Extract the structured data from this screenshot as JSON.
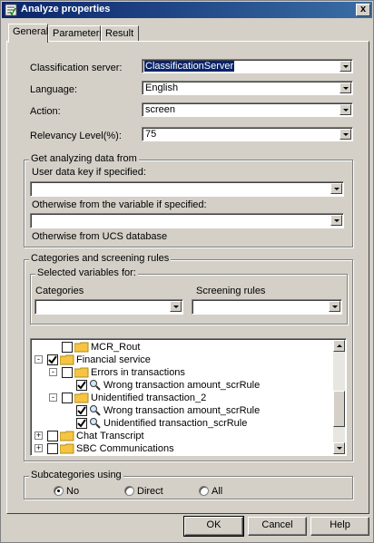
{
  "window": {
    "title": "Analyze properties",
    "close_glyph": "x"
  },
  "tabs": [
    {
      "label": "General"
    },
    {
      "label": "Parameters"
    },
    {
      "label": "Result"
    }
  ],
  "general": {
    "classification_server": {
      "label": "Classification server:",
      "value": "ClassificationServer"
    },
    "language": {
      "label": "Language:",
      "value": "English"
    },
    "action": {
      "label": "Action:",
      "value": "screen"
    },
    "relevancy": {
      "label": "Relevancy Level(%):",
      "value": "75"
    }
  },
  "analyzing": {
    "legend": "Get analyzing data from",
    "user_key_label": "User data key if specified:",
    "user_key_value": "",
    "variable_label": "Otherwise from the variable if specified:",
    "variable_value": "",
    "ucs_label": "Otherwise from UCS database"
  },
  "categories": {
    "legend": "Categories and screening rules",
    "selected_legend": "Selected variables for:",
    "categories_label": "Categories",
    "categories_value": "",
    "screening_label": "Screening rules",
    "screening_value": "",
    "tree": [
      {
        "label": "MCR_Rout",
        "checked": false,
        "icon": "folder-icon"
      },
      {
        "label": "Financial service",
        "checked": true,
        "icon": "folder-icon",
        "expander": "-"
      },
      {
        "label": "Errors in transactions",
        "checked": false,
        "icon": "folder-icon",
        "expander": "-"
      },
      {
        "label": "Wrong transaction amount_scrRule",
        "checked": true,
        "icon": "magnifier-icon"
      },
      {
        "label": "Unidentified transaction_2",
        "checked": false,
        "icon": "folder-icon",
        "expander": "-"
      },
      {
        "label": "Wrong transaction amount_scrRule",
        "checked": true,
        "icon": "magnifier-icon"
      },
      {
        "label": "Unidentified transaction_scrRule",
        "checked": true,
        "icon": "magnifier-icon"
      },
      {
        "label": "Chat Transcript",
        "checked": false,
        "icon": "folder-icon",
        "expander": "+"
      },
      {
        "label": "SBC Communications",
        "checked": false,
        "icon": "folder-icon",
        "expander": "+"
      }
    ]
  },
  "subcategories": {
    "legend": "Subcategories using",
    "options": [
      {
        "label": "No",
        "selected": true
      },
      {
        "label": "Direct",
        "selected": false
      },
      {
        "label": "All",
        "selected": false
      }
    ]
  },
  "buttons": {
    "ok": "OK",
    "cancel": "Cancel",
    "help": "Help"
  },
  "colors": {
    "titlebar": "#0a246a",
    "face": "#d4d0c8",
    "folder": "#f5c542",
    "selection": "#0a246a"
  }
}
